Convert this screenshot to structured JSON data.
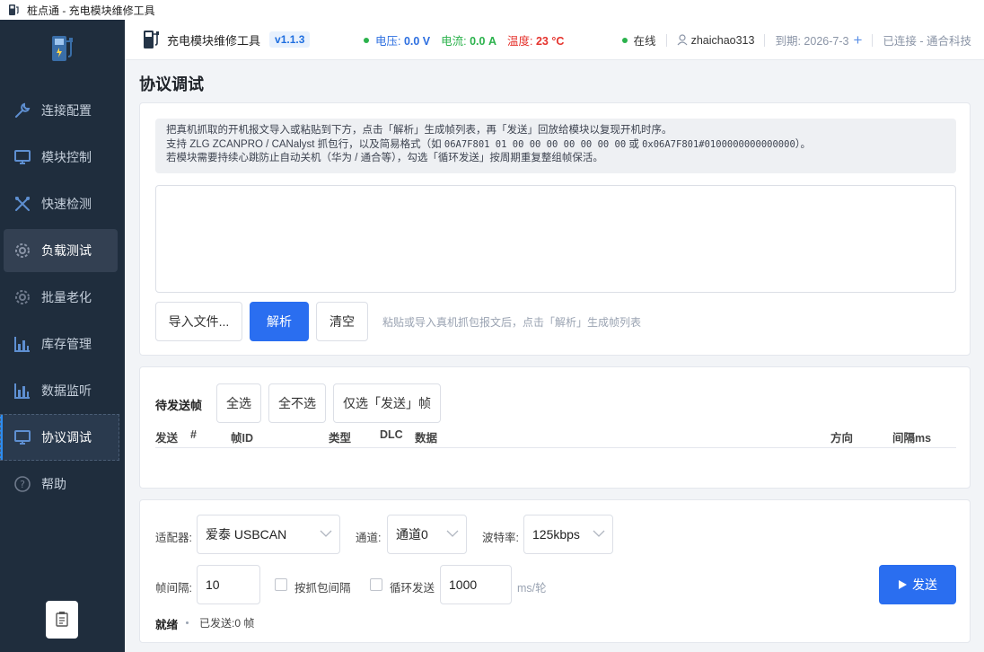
{
  "window": {
    "title": "桩点通 - 充电模块维修工具"
  },
  "sidebar": {
    "items": [
      {
        "label": "连接配置",
        "icon": "wrench-icon"
      },
      {
        "label": "模块控制",
        "icon": "monitor-icon"
      },
      {
        "label": "快速检测",
        "icon": "tools-icon"
      },
      {
        "label": "负载测试",
        "icon": "gear-icon"
      },
      {
        "label": "批量老化",
        "icon": "gear-icon"
      },
      {
        "label": "库存管理",
        "icon": "bar-chart-icon"
      },
      {
        "label": "数据监听",
        "icon": "bar-chart-icon"
      },
      {
        "label": "协议调试",
        "icon": "monitor-icon"
      },
      {
        "label": "帮助",
        "icon": "question-icon"
      }
    ]
  },
  "header": {
    "title": "充电模块维修工具",
    "version": "v1.1.3",
    "voltage_label": "电压: ",
    "voltage_value": "0.0 V",
    "current_label": "电流: ",
    "current_value": "0.0 A",
    "temp_label": "温度: ",
    "temp_value": "23 °C",
    "online": "在线",
    "username": "zhaichao313",
    "expiry": "到期: 2026-7-3",
    "plus": "+",
    "connection": "已连接 - 通合科技"
  },
  "page": {
    "title": "协议调试"
  },
  "import": {
    "tip_line1": "把真机抓取的开机报文导入或粘贴到下方，点击「解析」生成帧列表，再「发送」回放给模块以复现开机时序。",
    "tip_line2_a": "支持 ZLG ZCANPRO / CANalyst 抓包行，以及简易格式（如 ",
    "tip_line2_code1": "06A7F801 01 00 00 00 00 00 00 00",
    "tip_line2_or": " 或 ",
    "tip_line2_code2": "0x06A7F801#0100000000000000",
    "tip_line2_b": "）。",
    "tip_line3": "若模块需要持续心跳防止自动关机（华为 / 通合等），勾选「循环发送」按周期重复整组帧保活。",
    "textarea_value": "",
    "btn_import": "导入文件...",
    "btn_parse": "解析",
    "btn_clear": "清空",
    "hint": "粘贴或导入真机抓包报文后，点击「解析」生成帧列表"
  },
  "frames": {
    "title": "待发送帧",
    "btn_select_all": "全选",
    "btn_select_none": "全不选",
    "btn_select_send": "仅选「发送」帧",
    "columns": [
      "发送",
      "#",
      "帧ID",
      "类型",
      "DLC",
      "数据",
      "方向",
      "间隔ms"
    ],
    "rows": []
  },
  "send": {
    "adapter_label": "适配器:",
    "adapter_value": "爱泰 USBCAN",
    "channel_label": "通道:",
    "channel_value": "通道0",
    "baud_label": "波特率:",
    "baud_value": "125kbps",
    "interval_label": "帧间隔:",
    "interval_value": "10",
    "use_capture_interval_label": "按抓包间隔",
    "use_capture_interval_checked": false,
    "loop_label": "循环发送",
    "loop_checked": false,
    "loop_period_value": "1000",
    "loop_unit": "ms/轮",
    "send_button": "发送",
    "status": "就绪",
    "sent_count": "已发送:0 帧"
  }
}
